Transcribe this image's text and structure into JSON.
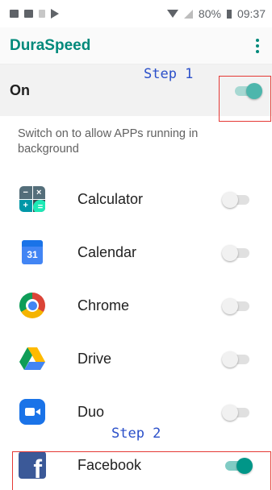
{
  "status_bar": {
    "battery_text": "80%",
    "time": "09:37"
  },
  "app_bar": {
    "title": "DuraSpeed",
    "menu_icon": "more-vert-icon"
  },
  "master_switch": {
    "label": "On",
    "state": "on"
  },
  "description": "Switch on to allow APPs running in background",
  "annotations": {
    "step1": "Step 1",
    "step2": "Step 2",
    "text_color": "#2a4fc9",
    "callout_color": "#e53935"
  },
  "apps": [
    {
      "name": "Calculator",
      "icon": "calculator-icon",
      "state": "off"
    },
    {
      "name": "Calendar",
      "icon": "calendar-icon",
      "icon_text": "31",
      "state": "off"
    },
    {
      "name": "Chrome",
      "icon": "chrome-icon",
      "state": "off"
    },
    {
      "name": "Drive",
      "icon": "drive-icon",
      "state": "off"
    },
    {
      "name": "Duo",
      "icon": "duo-icon",
      "state": "off"
    },
    {
      "name": "Facebook",
      "icon": "facebook-icon",
      "icon_text": "f",
      "state": "on"
    }
  ],
  "colors": {
    "accent": "#00897b",
    "switch_on": "#009688"
  }
}
